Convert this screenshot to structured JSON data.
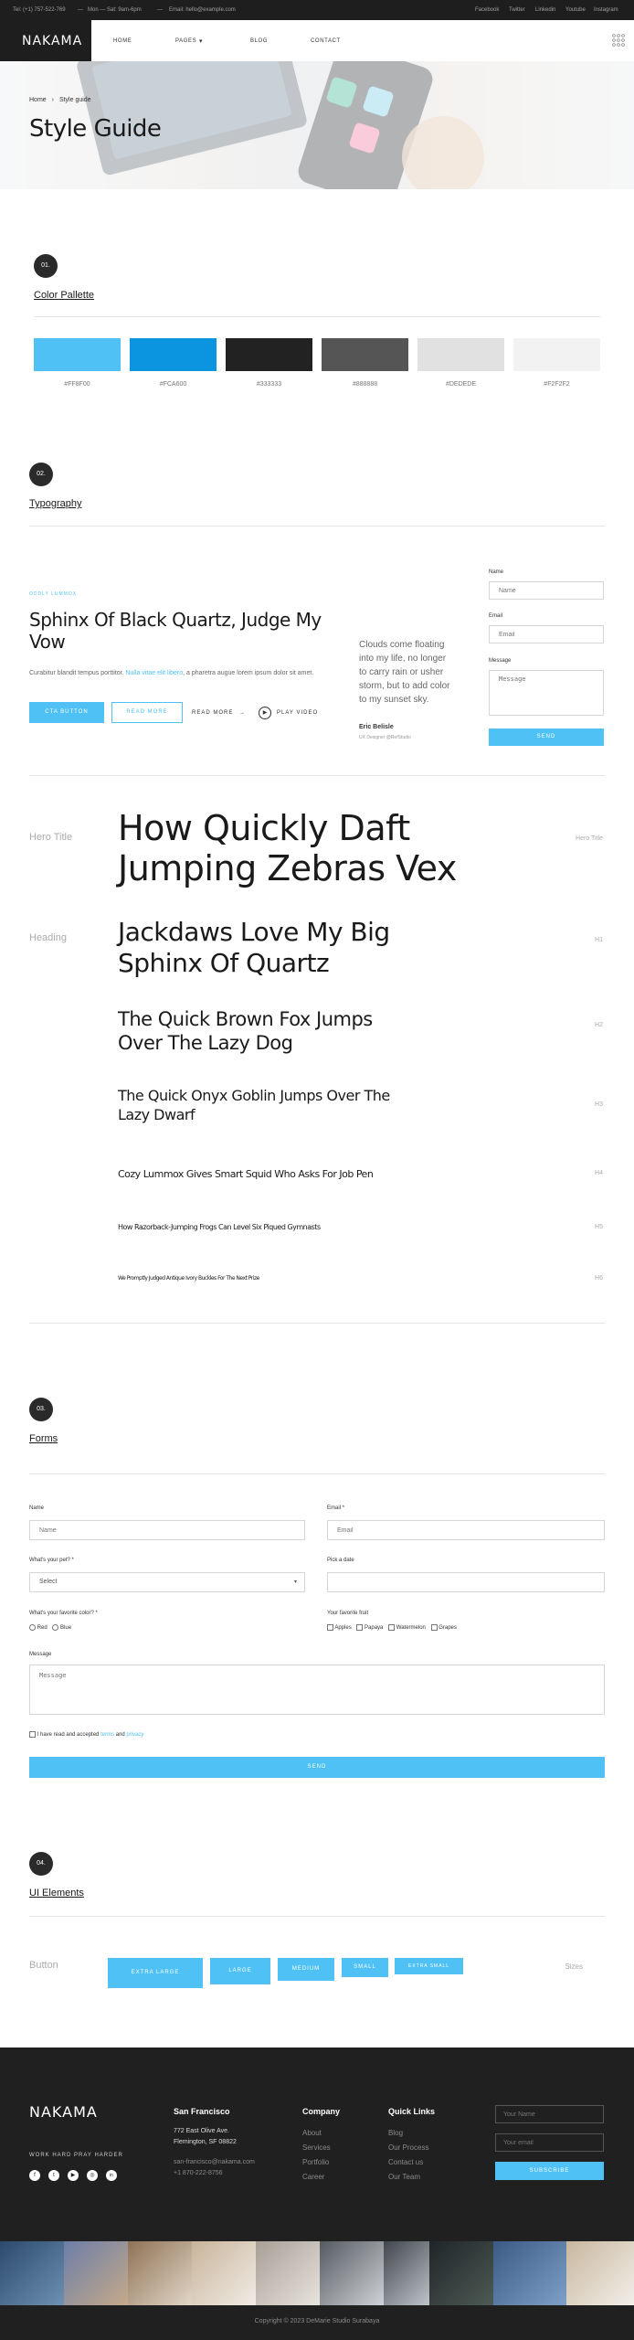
{
  "topbar": {
    "tel": "Tel: (+1) 757-522-769",
    "hours": "Mon — Sat: 9am-6pm",
    "email": "Email: hello@example.com",
    "social": [
      "Facebook",
      "Twitter",
      "Linkedin",
      "Youtube",
      "Instagram"
    ],
    "separator": "—"
  },
  "nav": {
    "logo": "NAKAMA",
    "links": [
      "HOME",
      "PAGES",
      "BLOG",
      "CONTACT"
    ],
    "pages_caret": "▾",
    "grid_icon": "grid-icon"
  },
  "hero": {
    "breadcrumb_home": "Home",
    "breadcrumb_sep": "›",
    "breadcrumb_current": "Style guide",
    "title": "Style Guide"
  },
  "sections": {
    "s1": {
      "num": "01.",
      "title": "Color Pallette"
    },
    "s2": {
      "num": "02.",
      "title": "Typography"
    },
    "s3": {
      "num": "03.",
      "title": "Forms"
    },
    "s4": {
      "num": "04.",
      "title": "UI Elements"
    }
  },
  "palette": [
    {
      "hex": "#4FC1F5",
      "label": "#FF8F00"
    },
    {
      "hex": "#0B94E0",
      "label": "#FCA600"
    },
    {
      "hex": "#222222",
      "label": "#333333"
    },
    {
      "hex": "#555555",
      "label": "#888888"
    },
    {
      "hex": "#E1E1E1",
      "label": "#DEDEDE"
    },
    {
      "hex": "#F2F2F2",
      "label": "#F2F2F2"
    }
  ],
  "typo_demo": {
    "eyebrow": "ODDLY LUMMOX",
    "heading": "Sphinx Of Black Quartz, Judge My Vow",
    "para_start": "Curabitur blandit tempus porttitor.",
    "para_link": "Nulla vitae elit libero",
    "para_end": ", a pharetra augue lorem ipsum dolor sit amet.",
    "btn_primary": "CTA BUTTON",
    "btn_outline": "READ MORE",
    "read_more": "READ MORE",
    "arrow": "→",
    "play": "PLAY VIDEO",
    "play_icon": "▶",
    "quote": "Clouds come floating into my life, no longer to carry rain or usher storm, but to add color to my sunset sky.",
    "quote_author": "Eric Belisle",
    "quote_role": "UX Designer @RefStudio",
    "mini_form": {
      "name_label": "Name",
      "name_ph": "Name",
      "email_label": "Email",
      "email_ph": "Email",
      "message_label": "Message",
      "message_ph": "Message",
      "send": "SEND"
    }
  },
  "type_scale": {
    "hero_label": "Hero Title",
    "hero_right": "Hero Title",
    "hero_text": "How Quickly Daft Jumping Zebras Vex",
    "heading_label": "Heading",
    "h1": "Jackdaws Love My Big Sphinx Of Quartz",
    "h2": "The Quick Brown Fox Jumps Over The Lazy Dog",
    "h3": "The Quick Onyx Goblin Jumps Over The Lazy Dwarf",
    "h4": "Cozy Lummox Gives Smart Squid Who Asks For Job Pen",
    "h5": "How Razorback-Jumping Frogs Can Level Six Piqued Gymnasts",
    "h6": "We Promptly Judged Antique Ivory Buckles For The Next Prize",
    "tags": [
      "H1",
      "H2",
      "H3",
      "H4",
      "H5",
      "H6"
    ]
  },
  "forms": {
    "name_label": "Name",
    "name_ph": "Name",
    "email_label": "Email *",
    "email_ph": "Email",
    "pet_label": "What's your pet? *",
    "pet_value": "Select",
    "date_label": "Pick a date",
    "color_label": "What's your favorite color? *",
    "colors": [
      "Red",
      "Blue"
    ],
    "fruit_label": "Your favorite fruit",
    "fruits": [
      "Apples",
      "Papaya",
      "Watermelon",
      "Grapes"
    ],
    "message_label": "Message",
    "message_ph": "Message",
    "accept_start": "I have read and accepted",
    "accept_terms": "terms",
    "accept_and": "and",
    "accept_privacy": "privacy",
    "send": "SEND"
  },
  "ui": {
    "button_label": "Button",
    "sizes_label": "Sizes",
    "buttons": [
      "EXTRA LARGE",
      "LARGE",
      "MEDIUM",
      "SMALL",
      "EXTRA SMALL"
    ]
  },
  "footer": {
    "logo": "NAKAMA",
    "tagline": "WORK HARD PRAY HARDER",
    "social_icons": [
      "facebook-icon",
      "twitter-icon",
      "youtube-icon",
      "instagram-icon",
      "linkedin-icon"
    ],
    "social_glyphs": [
      "f",
      "t",
      "▶",
      "◎",
      "in"
    ],
    "city": "San Francisco",
    "address1": "772 East Olive Ave.",
    "address2": "Flemington, SF 08822",
    "contact_email": "san-francisco@nakama.com",
    "phone": "+1 870-222-8756",
    "company_title": "Company",
    "company_links": [
      "About",
      "Services",
      "Portfolio",
      "Career"
    ],
    "quick_title": "Quick Links",
    "quick_links": [
      "Blog",
      "Our Process",
      "Contact us",
      "Our Team"
    ],
    "name_ph": "Your Name",
    "email_ph": "Your email",
    "subscribe": "SUBSCRIBE",
    "copyright": "Copyright © 2023 DeMarie Studio Surabaya"
  },
  "colors": {
    "accent": "#4FC1F5",
    "dark": "#202020"
  }
}
